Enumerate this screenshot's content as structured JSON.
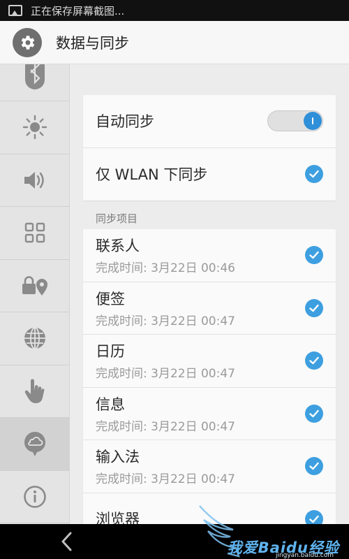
{
  "status_bar": {
    "text": "正在保存屏幕截图..."
  },
  "header": {
    "title": "数据与同步"
  },
  "sidebar": {
    "items": [
      {
        "icon": "bluetooth-icon"
      },
      {
        "icon": "brightness-icon"
      },
      {
        "icon": "volume-icon"
      },
      {
        "icon": "apps-grid-icon"
      },
      {
        "icon": "lock-location-icon"
      },
      {
        "icon": "globe-icon"
      },
      {
        "icon": "touch-hand-icon"
      },
      {
        "icon": "cloud-sync-icon",
        "active": true
      },
      {
        "icon": "info-icon"
      }
    ]
  },
  "settings": {
    "auto_sync_label": "自动同步",
    "auto_sync_on": true,
    "wlan_only_label": "仅 WLAN 下同步",
    "wlan_only_checked": true
  },
  "sync_items": {
    "header": "同步项目",
    "items": [
      {
        "name": "联系人",
        "status": "完成时间: 3月22日 00:46"
      },
      {
        "name": "便签",
        "status": "完成时间: 3月22日 00:47"
      },
      {
        "name": "日历",
        "status": "完成时间: 3月22日 00:47"
      },
      {
        "name": "信息",
        "status": "完成时间: 3月22日 00:47"
      },
      {
        "name": "输入法",
        "status": "完成时间: 3月22日 00:47"
      },
      {
        "name": "浏览器",
        "status": ""
      }
    ]
  },
  "watermark": {
    "main": "我爱Baidu经验",
    "sub": "jingyan.baidu.com"
  },
  "colors": {
    "accent": "#3d9fe0",
    "toggle_knob": "#2f8fd8"
  }
}
